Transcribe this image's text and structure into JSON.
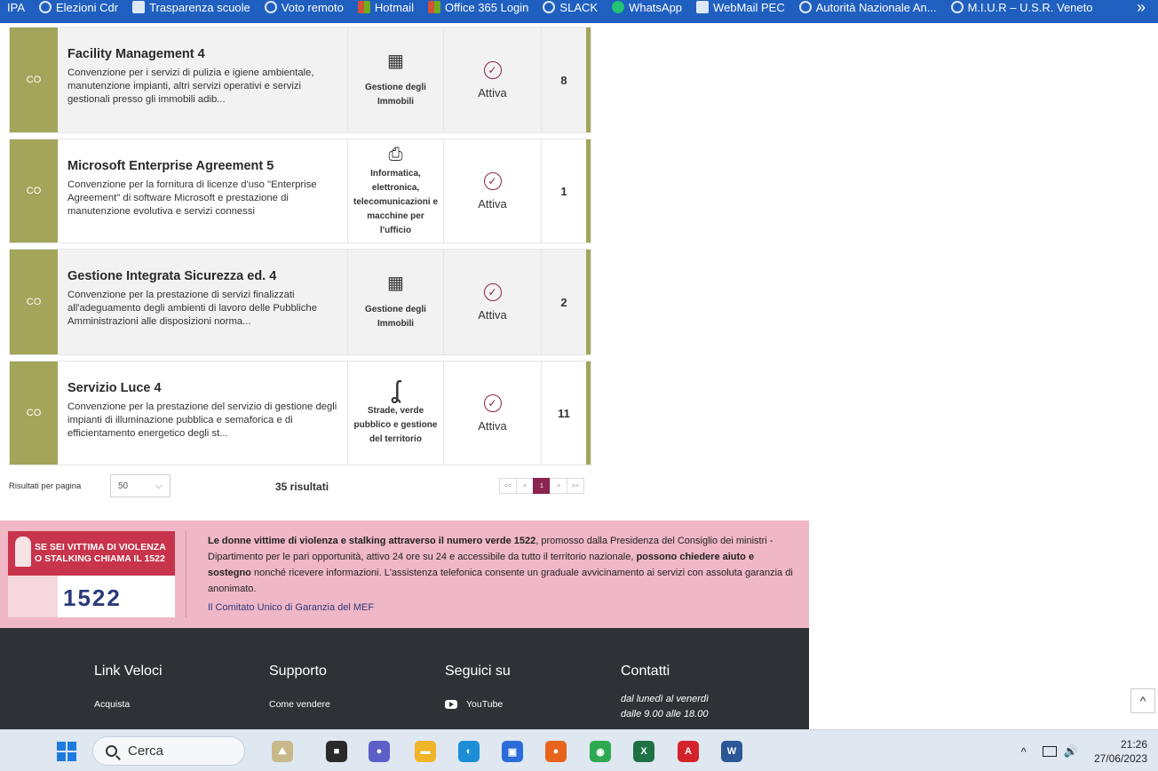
{
  "bookmarks": [
    {
      "label": "IPA",
      "icon": "none"
    },
    {
      "label": "Elezioni Cdr",
      "icon": "vote-icon"
    },
    {
      "label": "Trasparenza scuole",
      "icon": "school-icon"
    },
    {
      "label": "Voto remoto",
      "icon": "cloud-icon"
    },
    {
      "label": "Hotmail",
      "icon": "ms-icon"
    },
    {
      "label": "Office 365 Login",
      "icon": "ms-icon"
    },
    {
      "label": "SLACK",
      "icon": "globe-icon"
    },
    {
      "label": "WhatsApp",
      "icon": "whatsapp-icon"
    },
    {
      "label": "WebMail PEC",
      "icon": "mail-icon"
    },
    {
      "label": "Autorità Nazionale An...",
      "icon": "globe-icon"
    },
    {
      "label": "M.I.U.R – U.S.R. Veneto",
      "icon": "globe-icon"
    }
  ],
  "bookmarks_more": "»",
  "cards": [
    {
      "tag": "CO",
      "title": "Facility Management 4",
      "desc": "Convenzione per i servizi di pulizia e igiene ambientale, manutenzione impianti, altri servizi operativi e servizi gestionali presso gli immobili adib...",
      "category_icon": "building-icon",
      "category_glyph": "▦",
      "category": "Gestione degli Immobili",
      "status": "Attiva",
      "count": "8"
    },
    {
      "tag": "CO",
      "title": "Microsoft Enterprise Agreement 5",
      "desc": "Convenzione per la fornitura di licenze d'uso \"Enterprise Agreement\" di software Microsoft e prestazione di manutenzione evolutiva e servizi connessi",
      "category_icon": "printer-icon",
      "category_glyph": "⎙",
      "category": "Informatica, elettronica, telecomunicazioni e macchine per l'ufficio",
      "status": "Attiva",
      "count": "1"
    },
    {
      "tag": "CO",
      "title": "Gestione Integrata Sicurezza ed. 4",
      "desc": "Convenzione per la prestazione di servizi finalizzati all'adeguamento degli ambienti di lavoro delle Pubbliche Amministrazioni alle disposizioni norma...",
      "category_icon": "building-icon",
      "category_glyph": "▦",
      "category": "Gestione degli Immobili",
      "status": "Attiva",
      "count": "2"
    },
    {
      "tag": "CO",
      "title": "Servizio Luce 4",
      "desc": "Convenzione per la prestazione del servizio di gestione degli impianti di illuminazione pubblica e semaforica e di efficientamento energetico degli st...",
      "category_icon": "road-icon",
      "category_glyph": "ʆ",
      "category": "Strade, verde pubblico e gestione del territorio",
      "status": "Attiva",
      "count": "11"
    }
  ],
  "results": {
    "per_page_label": "Risultati per pagina",
    "per_page_value": "50",
    "total_label": "35 risultati",
    "pager": [
      "<<",
      "<",
      "1",
      ">",
      ">>"
    ],
    "current_page": "1"
  },
  "banner": {
    "poster_text": "SE SEI VITTIMA DI VIOLENZA O STALKING CHIAMA IL 1522",
    "poster_number": "1522",
    "text_bold1": "Le donne vittime di violenza e stalking attraverso il numero verde 1522",
    "text_1": ", promosso dalla Presidenza del Consiglio dei ministri - Dipartimento per le pari opportunità, attivo 24 ore su 24 e accessibile da tutto il territorio nazionale, ",
    "text_bold2": "possono chiedere aiuto e sostegno",
    "text_2": " nonché ricevere informazioni. L'assistenza telefonica consente un graduale avvicinamento ai servizi con assoluta garanzia di anonimato.",
    "link": "Il Comitato Unico di Garanzia del MEF"
  },
  "footer": {
    "cols": [
      {
        "heading": "Link Veloci",
        "item": "Acquista"
      },
      {
        "heading": "Supporto",
        "item": "Come vendere"
      },
      {
        "heading": "Seguici su",
        "item": "YouTube"
      },
      {
        "heading": "Contatti",
        "line1": "dal lunedì al venerdì",
        "line2": "dalle 9.00 alle 18.00"
      }
    ]
  },
  "scroll_top": "^",
  "taskbar": {
    "search_placeholder": "Cerca",
    "time": "21:26",
    "date": "27/06/2023",
    "tray_chevron": "^",
    "volume": "🔊",
    "apps": [
      {
        "name": "landscape-app-icon",
        "color": "#c9b98a",
        "glyph": "⛰"
      },
      {
        "name": "taskview-icon",
        "color": "#2a2a2a",
        "glyph": "■"
      },
      {
        "name": "chat-icon",
        "color": "#5b5fc7",
        "glyph": "●"
      },
      {
        "name": "file-explorer-icon",
        "color": "#f0b429",
        "glyph": "▬"
      },
      {
        "name": "edge-icon",
        "color": "#1b8fd6",
        "glyph": "◐"
      },
      {
        "name": "store-icon",
        "color": "#2b6cd8",
        "glyph": "▣"
      },
      {
        "name": "firefox-icon",
        "color": "#e8631c",
        "glyph": "●"
      },
      {
        "name": "chrome-icon",
        "color": "#2da94f",
        "glyph": "◉"
      },
      {
        "name": "excel-icon",
        "color": "#1e7145",
        "glyph": "X"
      },
      {
        "name": "acrobat-icon",
        "color": "#d4222a",
        "glyph": "A"
      },
      {
        "name": "word-icon",
        "color": "#2b5797",
        "glyph": "W"
      }
    ]
  }
}
